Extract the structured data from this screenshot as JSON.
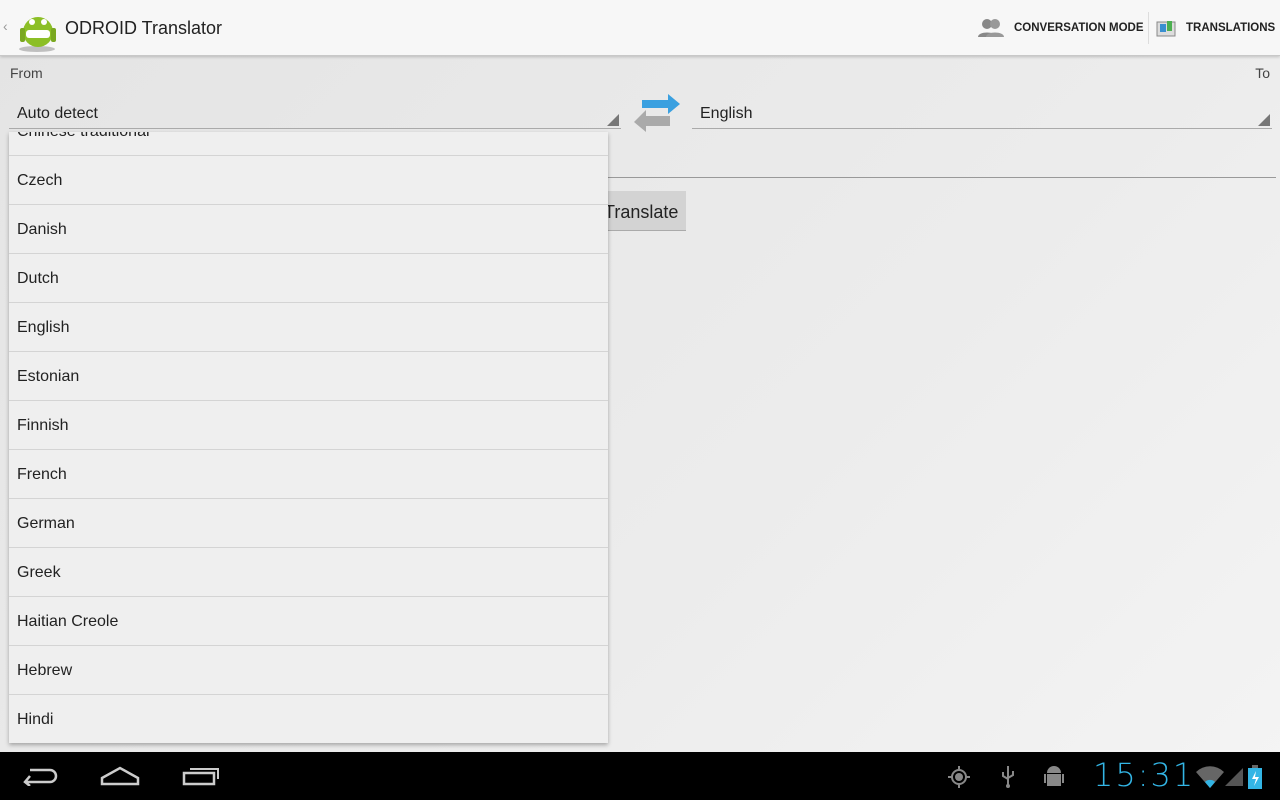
{
  "app": {
    "title": "ODROID Translator"
  },
  "actions": [
    {
      "label": "CONVERSATION MODE",
      "icon": "people-icon"
    },
    {
      "label": "TRANSLATIONS",
      "icon": "book-icon"
    }
  ],
  "from": {
    "label": "From",
    "value": "Auto detect"
  },
  "to": {
    "label": "To",
    "value": "English"
  },
  "input": {
    "value": ""
  },
  "translate_label": "Translate",
  "languages": [
    "Chinese traditional",
    "Czech",
    "Danish",
    "Dutch",
    "English",
    "Estonian",
    "Finnish",
    "French",
    "German",
    "Greek",
    "Haitian Creole",
    "Hebrew",
    "Hindi"
  ],
  "status": {
    "time": "15:31"
  },
  "colors": {
    "accent": "#33b5e5",
    "navbar": "#000000"
  }
}
